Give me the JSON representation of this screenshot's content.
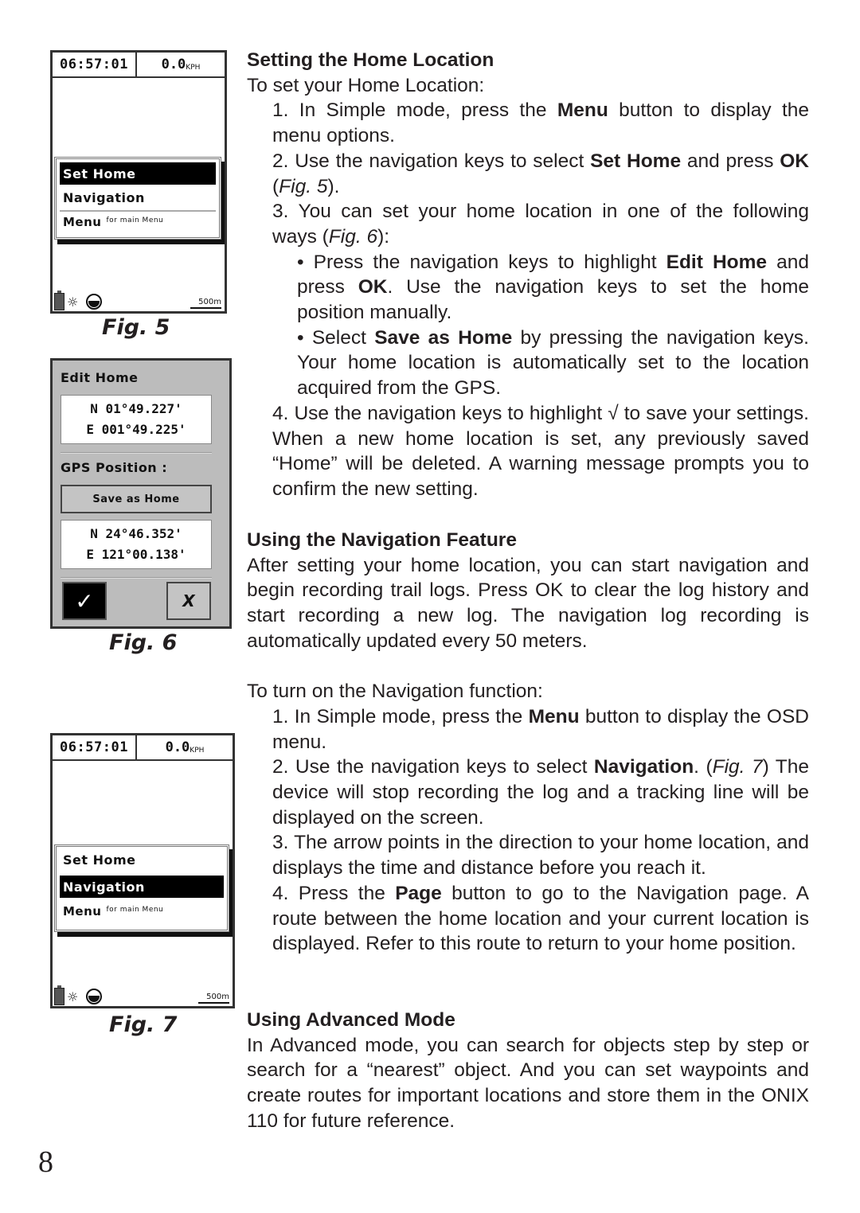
{
  "page_number": "8",
  "figures": {
    "fig5": {
      "caption": "Fig. 5",
      "time": "06:57:01",
      "speed": "0.0",
      "speed_unit": "KPH",
      "menu": {
        "items": [
          {
            "label": "Set Home",
            "selected": true
          },
          {
            "label": "Navigation",
            "selected": false
          }
        ],
        "last_label": "Menu",
        "last_hint": "for main Menu"
      },
      "status": {
        "bulb_icon": "☼",
        "scale": "500m",
        "battery_icon": "battery-icon",
        "compass_icon": "compass-icon"
      }
    },
    "fig6": {
      "caption": "Fig. 6",
      "edit_home_label": "Edit Home",
      "home_coords": [
        "N 01°49.227'",
        "E 001°49.225'"
      ],
      "gps_label": "GPS Position :",
      "save_button": "Save as Home",
      "gps_coords": [
        "N 24°46.352'",
        "E 121°00.138'"
      ],
      "ok_glyph": "✓",
      "cancel_glyph": "X"
    },
    "fig7": {
      "caption": "Fig. 7",
      "time": "06:57:01",
      "speed": "0.0",
      "speed_unit": "KPH",
      "menu": {
        "items": [
          {
            "label": "Set Home",
            "selected": false
          },
          {
            "label": "Navigation",
            "selected": true
          }
        ],
        "last_label": "Menu",
        "last_hint": "for main Menu"
      },
      "status": {
        "bulb_icon": "☼",
        "scale": "500m"
      }
    }
  },
  "sections": {
    "home": {
      "heading": "Setting the Home Location",
      "intro": "To set your Home Location:",
      "step1": {
        "a": "1. In Simple mode, press the ",
        "b": "Menu",
        "c": " button to display the menu options."
      },
      "step2": {
        "a": "2. Use the navigation keys to select ",
        "b": "Set Home",
        "c": " and press ",
        "d": "OK",
        "e": " (",
        "f": "Fig. 5",
        "g": ")."
      },
      "step3": {
        "a": "3. You can set your home location in one of the following ways (",
        "b": "Fig. 6",
        "c": "):"
      },
      "bullet1": {
        "a": "• Press the navigation keys to highlight ",
        "b": "Edit Home",
        "c": " and press ",
        "d": "OK",
        "e": ". Use the navigation keys to set the home position manually."
      },
      "bullet2": {
        "a": "• Select ",
        "b": "Save as Home",
        "c": " by pressing the navigation keys. Your home location is automatically set to the location acquired from the GPS."
      },
      "step4": "4. Use the navigation keys to highlight √ to save your settings. When a new home location is set, any previously saved “Home” will be deleted. A warning message prompts you to confirm the new setting."
    },
    "navigation": {
      "heading": "Using the Navigation Feature",
      "body": "After setting your home location, you can start navigation and begin recording trail logs. Press OK to clear the log history and start recording a new log. The navigation log recording is automatically updated every 50 meters.",
      "intro": "To turn on the Navigation function:",
      "step1": {
        "a": "1. In Simple mode, press the ",
        "b": "Menu",
        "c": " button to display the OSD menu."
      },
      "step2": {
        "a": "2. Use the navigation keys to select ",
        "b": "Navigation",
        "c": ". (",
        "d": "Fig. 7",
        "e": ") The device will stop recording the log and a tracking line will be displayed on the screen."
      },
      "step3": "3. The arrow points in the direction to your home location, and displays the time and distance before you reach it.",
      "step4": {
        "a": "4. Press the ",
        "b": "Page",
        "c": " button to go to the Navigation page. A route between the home location and your current location is displayed. Refer to this route to return to your home position."
      }
    },
    "advanced": {
      "heading": "Using Advanced Mode",
      "body": "In Advanced mode, you can search for objects step by step or search for a “nearest” object. And you can set waypoints and create routes for important locations and store them in the ONIX 110 for future reference."
    }
  }
}
